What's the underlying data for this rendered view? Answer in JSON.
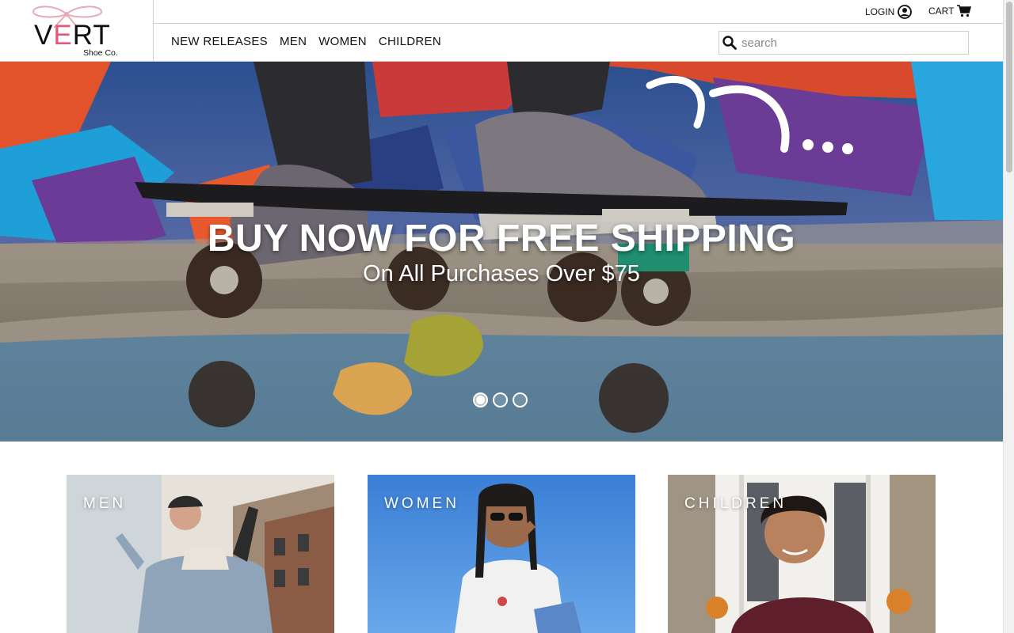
{
  "brand": {
    "word_pre": "V",
    "word_e": "E",
    "word_post": "RT",
    "tagline": "Shoe Co.",
    "accent": "#e05a79"
  },
  "utility": {
    "login": "LOGIN",
    "cart": "CART"
  },
  "nav": [
    "NEW RELEASES",
    "MEN",
    "WOMEN",
    "CHILDREN"
  ],
  "search": {
    "placeholder": "search",
    "value": ""
  },
  "hero": {
    "title": "BUY NOW FOR FREE SHIPPING",
    "subtitle": "On All Purchases Over $75",
    "slides": 3,
    "active_slide": 1
  },
  "categories": [
    {
      "label": "MEN"
    },
    {
      "label": "WOMEN"
    },
    {
      "label": "CHILDREN"
    }
  ],
  "icons": {
    "login": "user-circle-icon",
    "cart": "cart-icon",
    "search": "search-icon"
  }
}
